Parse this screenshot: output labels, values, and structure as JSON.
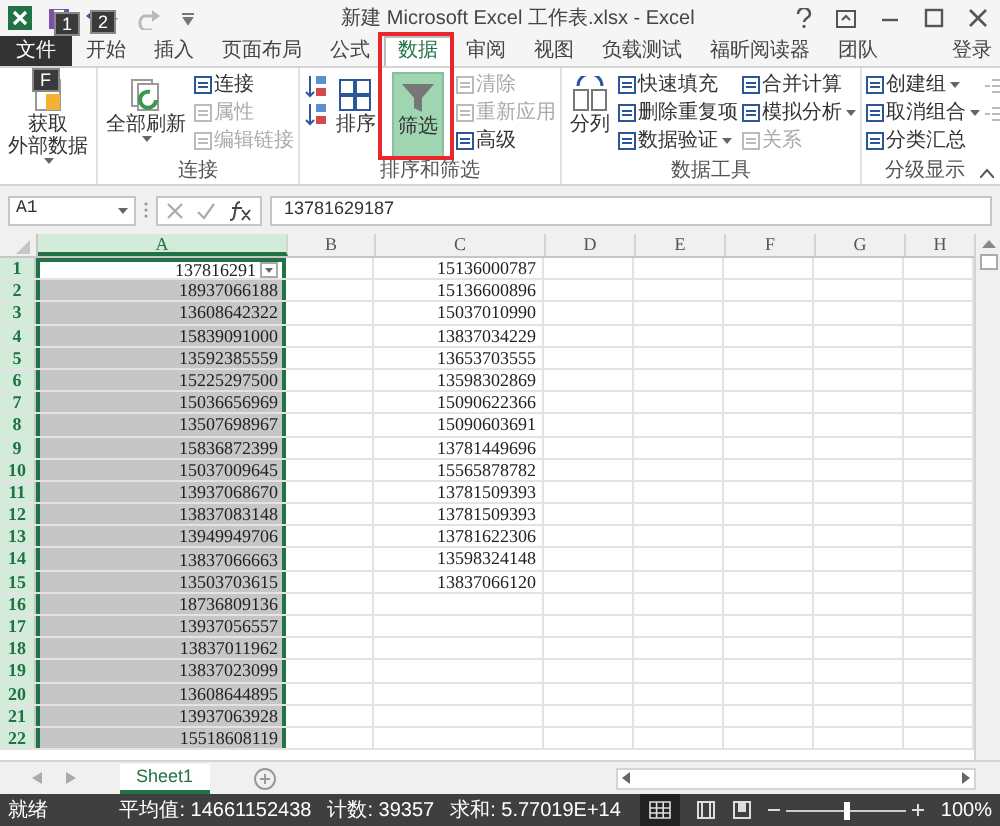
{
  "window": {
    "title": "新建 Microsoft Excel 工作表.xlsx - Excel",
    "key_tips": [
      "1",
      "2",
      "F"
    ]
  },
  "tabs": [
    {
      "label": "文件",
      "selected": false,
      "kind": "file"
    },
    {
      "label": "开始",
      "selected": false,
      "kind": "tab"
    },
    {
      "label": "插入",
      "selected": false,
      "kind": "tab"
    },
    {
      "label": "页面布局",
      "selected": false,
      "kind": "tab"
    },
    {
      "label": "公式",
      "selected": false,
      "kind": "tab"
    },
    {
      "label": "数据",
      "selected": true,
      "kind": "tab"
    },
    {
      "label": "审阅",
      "selected": false,
      "kind": "tab"
    },
    {
      "label": "视图",
      "selected": false,
      "kind": "tab"
    },
    {
      "label": "负载测试",
      "selected": false,
      "kind": "tab"
    },
    {
      "label": "福昕阅读器",
      "selected": false,
      "kind": "tab"
    },
    {
      "label": "团队",
      "selected": false,
      "kind": "tab"
    }
  ],
  "account": "登录",
  "ribbon": {
    "groups": [
      {
        "items": [
          {
            "label_lines": [
              "获取",
              "外部数据"
            ],
            "kind": "large",
            "dropdown": true,
            "disabled": false,
            "selected": false
          }
        ]
      },
      {
        "label": "连接",
        "items": [
          {
            "label_lines": [
              "全部刷新"
            ],
            "kind": "large",
            "dropdown": true,
            "disabled": false,
            "selected": false
          },
          {
            "label": "连接",
            "kind": "small",
            "dropdown": false,
            "disabled": false,
            "selected": false
          },
          {
            "label": "属性",
            "kind": "small",
            "dropdown": false,
            "disabled": true,
            "selected": false
          },
          {
            "label": "编辑链接",
            "kind": "small",
            "dropdown": false,
            "disabled": true,
            "selected": false
          }
        ]
      },
      {
        "label": "排序和筛选",
        "items": [
          {
            "kind": "icon",
            "dropdown": false,
            "disabled": false,
            "selected": false
          },
          {
            "kind": "icon",
            "dropdown": false,
            "disabled": false,
            "selected": false
          },
          {
            "label_lines": [
              "排序"
            ],
            "kind": "large",
            "dropdown": false,
            "disabled": false,
            "selected": false
          },
          {
            "label_lines": [
              "筛选"
            ],
            "kind": "large",
            "dropdown": false,
            "disabled": false,
            "selected": true
          },
          {
            "label": "清除",
            "kind": "small",
            "dropdown": false,
            "disabled": true,
            "selected": false
          },
          {
            "label": "重新应用",
            "kind": "small",
            "dropdown": false,
            "disabled": true,
            "selected": false
          },
          {
            "label": "高级",
            "kind": "small",
            "dropdown": false,
            "disabled": false,
            "selected": false
          }
        ]
      },
      {
        "label": "数据工具",
        "items": [
          {
            "label_lines": [
              "分列"
            ],
            "kind": "large",
            "dropdown": false,
            "disabled": false,
            "selected": false
          },
          {
            "label": "快速填充",
            "kind": "small",
            "dropdown": false,
            "disabled": false,
            "selected": false
          },
          {
            "label": "删除重复项",
            "kind": "small",
            "dropdown": false,
            "disabled": false,
            "selected": false
          },
          {
            "label": "数据验证",
            "kind": "small",
            "dropdown": true,
            "disabled": false,
            "selected": false
          },
          {
            "label": "合并计算",
            "kind": "small",
            "dropdown": false,
            "disabled": false,
            "selected": false
          },
          {
            "label": "模拟分析",
            "kind": "small",
            "dropdown": true,
            "disabled": false,
            "selected": false
          },
          {
            "label": "关系",
            "kind": "small",
            "dropdown": false,
            "disabled": true,
            "selected": false
          }
        ]
      },
      {
        "label": "分级显示",
        "items": [
          {
            "label": "创建组",
            "kind": "small",
            "dropdown": true,
            "disabled": false,
            "selected": false
          },
          {
            "label": "取消组合",
            "kind": "small",
            "dropdown": true,
            "disabled": false,
            "selected": false
          },
          {
            "label": "分类汇总",
            "kind": "small",
            "dropdown": false,
            "disabled": false,
            "selected": false
          },
          {
            "kind": "icon",
            "dropdown": false,
            "disabled": true,
            "selected": false
          },
          {
            "kind": "icon",
            "dropdown": false,
            "disabled": true,
            "selected": false
          }
        ]
      }
    ]
  },
  "annotation": {
    "kind": "frame"
  },
  "name_box": "A1",
  "formula": "13781629187",
  "columns": [
    {
      "label": "A",
      "selected": true
    },
    {
      "label": "B",
      "selected": false
    },
    {
      "label": "C",
      "selected": false
    },
    {
      "label": "D",
      "selected": false
    },
    {
      "label": "E",
      "selected": false
    },
    {
      "label": "F",
      "selected": false
    },
    {
      "label": "G",
      "selected": false
    },
    {
      "label": "H",
      "selected": false
    }
  ],
  "rows": [
    {
      "number": "1",
      "a": "137816291",
      "c": "15136000787",
      "selected": true,
      "filter": true
    },
    {
      "number": "2",
      "a": "18937066188",
      "c": "15136600896",
      "selected": true,
      "filter": false
    },
    {
      "number": "3",
      "a": "13608642322",
      "c": "15037010990",
      "selected": true,
      "filter": false
    },
    {
      "number": "4",
      "a": "15839091000",
      "c": "13837034229",
      "selected": true,
      "filter": false
    },
    {
      "number": "5",
      "a": "13592385559",
      "c": "13653703555",
      "selected": true,
      "filter": false
    },
    {
      "number": "6",
      "a": "15225297500",
      "c": "13598302869",
      "selected": true,
      "filter": false
    },
    {
      "number": "7",
      "a": "15036656969",
      "c": "15090622366",
      "selected": true,
      "filter": false
    },
    {
      "number": "8",
      "a": "13507698967",
      "c": "15090603691",
      "selected": true,
      "filter": false
    },
    {
      "number": "9",
      "a": "15836872399",
      "c": "13781449696",
      "selected": true,
      "filter": false
    },
    {
      "number": "10",
      "a": "15037009645",
      "c": "15565878782",
      "selected": true,
      "filter": false
    },
    {
      "number": "11",
      "a": "13937068670",
      "c": "13781509393",
      "selected": true,
      "filter": false
    },
    {
      "number": "12",
      "a": "13837083148",
      "c": "13781509393",
      "selected": true,
      "filter": false
    },
    {
      "number": "13",
      "a": "13949949706",
      "c": "13781622306",
      "selected": true,
      "filter": false
    },
    {
      "number": "14",
      "a": "13837066663",
      "c": "13598324148",
      "selected": true,
      "filter": false
    },
    {
      "number": "15",
      "a": "13503703615",
      "c": "13837066120",
      "selected": true,
      "filter": false
    },
    {
      "number": "16",
      "a": "18736809136",
      "selected": true,
      "filter": false
    },
    {
      "number": "17",
      "a": "13937056557",
      "selected": true,
      "filter": false
    },
    {
      "number": "18",
      "a": "13837011962",
      "selected": true,
      "filter": false
    },
    {
      "number": "19",
      "a": "13837023099",
      "selected": true,
      "filter": false
    },
    {
      "number": "20",
      "a": "13608644895",
      "selected": true,
      "filter": false
    },
    {
      "number": "21",
      "a": "13937063928",
      "selected": true,
      "filter": false
    },
    {
      "number": "22",
      "a": "15518608119",
      "selected": true,
      "filter": false
    }
  ],
  "sheet_tabs": [
    {
      "label": "Sheet1",
      "selected": true
    }
  ],
  "status_bar": {
    "state": "就绪",
    "average": "平均值: 14661152438",
    "count": "计数: 39357",
    "sum": "求和: 5.77019E+14",
    "zoom": "100%",
    "zoom_slider": {
      "level": 0.5
    }
  }
}
